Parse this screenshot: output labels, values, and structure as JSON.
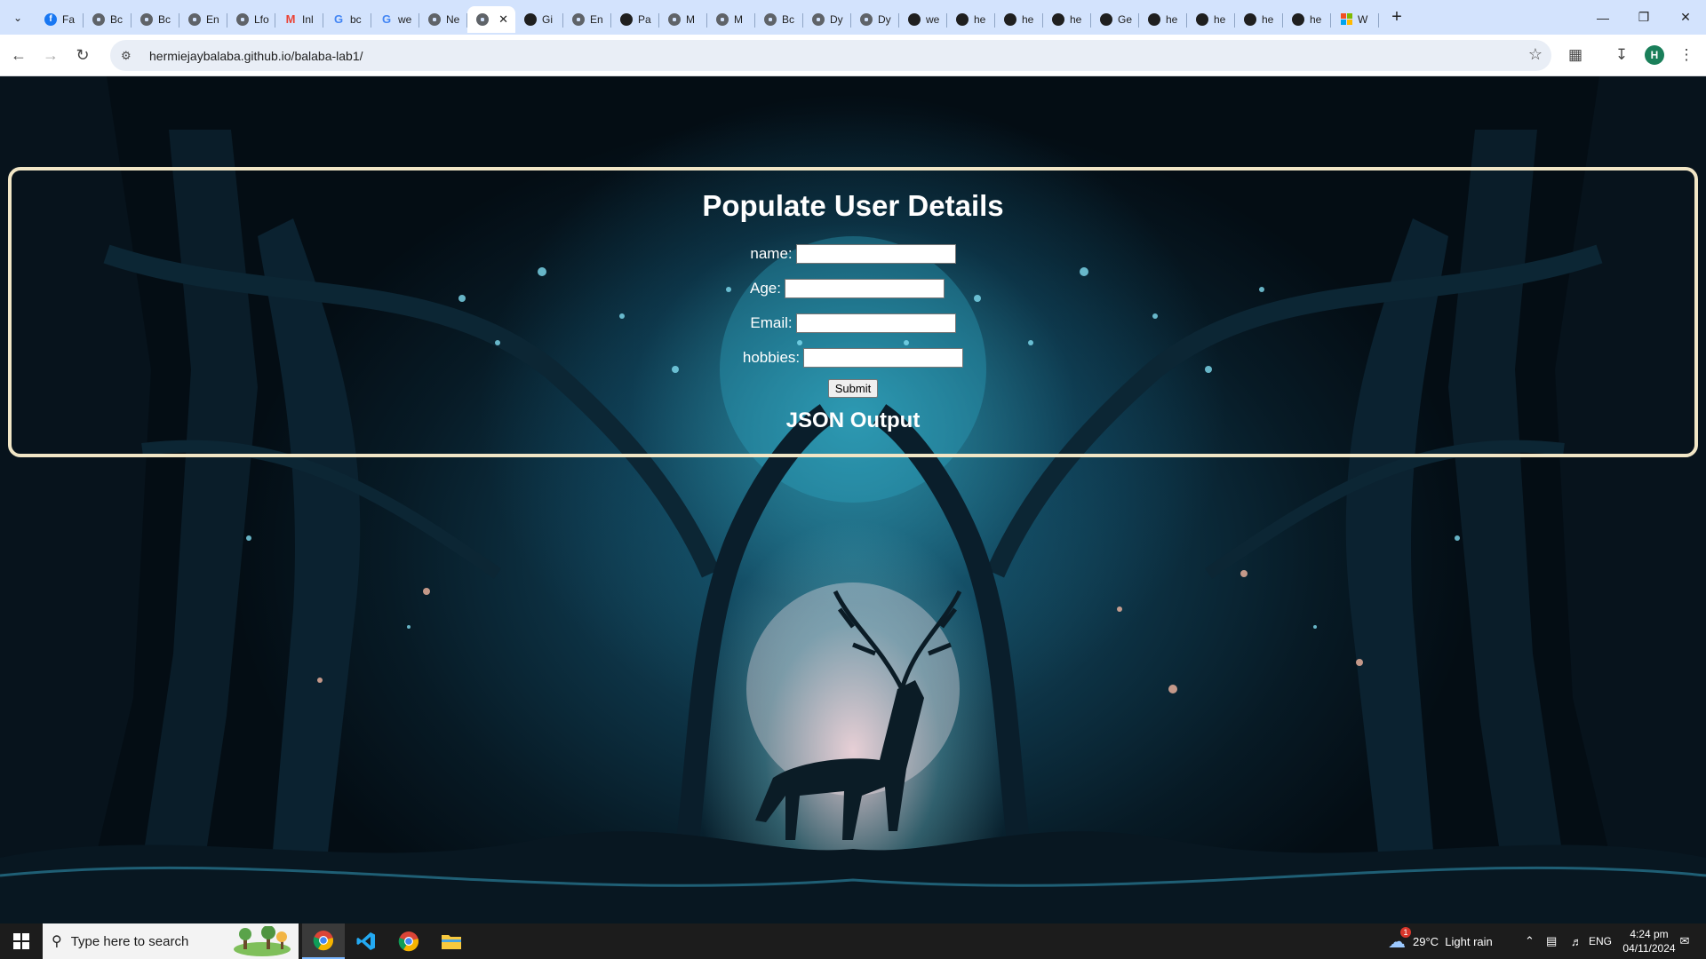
{
  "browser": {
    "tabs": [
      {
        "label": "Fa",
        "icon": "facebook-icon",
        "color": "#1877f2"
      },
      {
        "label": "Bc",
        "icon": "globe-icon"
      },
      {
        "label": "Bc",
        "icon": "globe-icon"
      },
      {
        "label": "En",
        "icon": "globe-icon"
      },
      {
        "label": "Lfo",
        "icon": "globe-icon"
      },
      {
        "label": "Inl",
        "icon": "gmail-icon"
      },
      {
        "label": "bc",
        "icon": "google-icon"
      },
      {
        "label": "we",
        "icon": "google-icon"
      },
      {
        "label": "Ne",
        "icon": "globe-icon"
      },
      {
        "label": "",
        "icon": "globe-icon",
        "active": true
      },
      {
        "label": "Gi",
        "icon": "github-icon"
      },
      {
        "label": "En",
        "icon": "globe-icon"
      },
      {
        "label": "Pa",
        "icon": "github-icon"
      },
      {
        "label": "M",
        "icon": "globe-icon"
      },
      {
        "label": "M",
        "icon": "globe-icon"
      },
      {
        "label": "Bc",
        "icon": "globe-icon"
      },
      {
        "label": "Dy",
        "icon": "globe-icon"
      },
      {
        "label": "Dy",
        "icon": "globe-icon"
      },
      {
        "label": "we",
        "icon": "github-icon"
      },
      {
        "label": "he",
        "icon": "github-icon"
      },
      {
        "label": "he",
        "icon": "github-icon"
      },
      {
        "label": "he",
        "icon": "github-icon"
      },
      {
        "label": "Ge",
        "icon": "github-icon"
      },
      {
        "label": "he",
        "icon": "github-icon"
      },
      {
        "label": "he",
        "icon": "github-icon"
      },
      {
        "label": "he",
        "icon": "github-icon"
      },
      {
        "label": "he",
        "icon": "github-icon"
      },
      {
        "label": "W",
        "icon": "windows-icon"
      }
    ],
    "url": "hermiejaybalaba.github.io/balaba-lab1/",
    "profile_initial": "H"
  },
  "page": {
    "title": "Populate User Details",
    "fields": [
      {
        "label": "name:",
        "value": ""
      },
      {
        "label": "Age:",
        "value": ""
      },
      {
        "label": "Email:",
        "value": ""
      },
      {
        "label": "hobbies:",
        "value": ""
      }
    ],
    "submit_label": "Submit",
    "output_title": "JSON Output"
  },
  "taskbar": {
    "search_placeholder": "Type here to search",
    "weather": "29°C  Light rain",
    "weather_badge": "1",
    "language": "ENG",
    "time": "4:24 pm",
    "date": "04/11/2024"
  },
  "colors": {
    "panel_border": "#f1e6c6",
    "tabstrip": "#d3e3fd",
    "taskbar": "#1c1c1c"
  }
}
